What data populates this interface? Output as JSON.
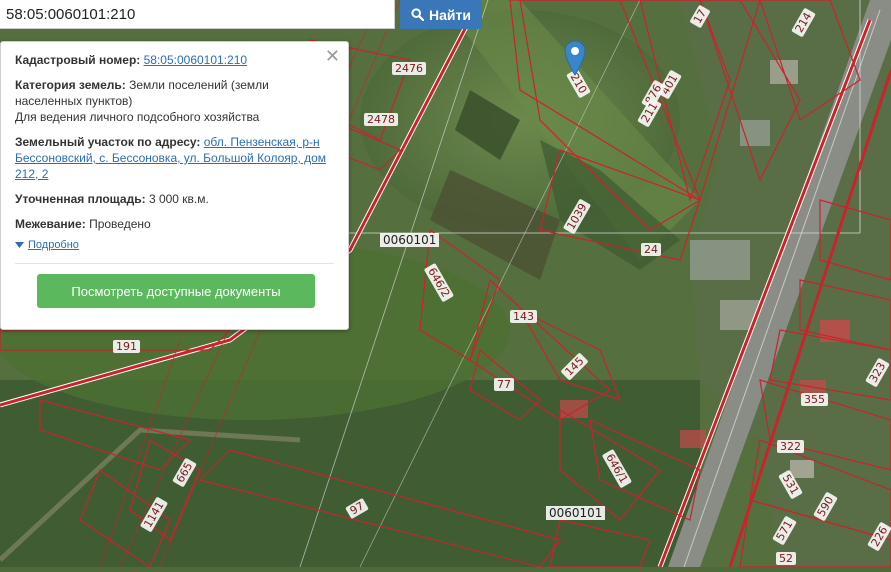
{
  "search": {
    "value": "58:05:0060101:210",
    "button_label": "Найти"
  },
  "popup": {
    "cadastral_label": "Кадастровый номер:",
    "cadastral_value": "58:05:0060101:210",
    "category_label": "Категория земель:",
    "category_value": "Земли поселений (земли населенных пунктов)",
    "use_value": "Для ведения личного подсобного хозяйства",
    "address_label": "Земельный участок по адресу:",
    "address_value": "обл. Пензенская, р-н Бессоновский, с. Бессоновка, ул. Большой Колояр, дом 212, 2",
    "area_label": "Уточненная площадь:",
    "area_value": "3 000 кв.м.",
    "survey_label": "Межевание:",
    "survey_value": "Проведено",
    "details_label": "Подробно",
    "docs_button": "Посмотреть доступные документы"
  },
  "map": {
    "quarter_labels": [
      "0060101",
      "0060101"
    ],
    "parcel_labels": [
      "17",
      "214",
      "2476",
      "210",
      "401",
      "876",
      "211",
      "2478",
      "1039",
      "24",
      "646/2",
      "143",
      "191",
      "145",
      "77",
      "323",
      "355",
      "322",
      "646/1",
      "665",
      "97",
      "1141",
      "531",
      "590",
      "571",
      "52",
      "226"
    ]
  },
  "colors": {
    "boundary": "#c8242c",
    "search_button": "#3a77b8",
    "docs_button": "#5cb85c",
    "link": "#2a6fb0",
    "marker": "#3b86c9"
  }
}
